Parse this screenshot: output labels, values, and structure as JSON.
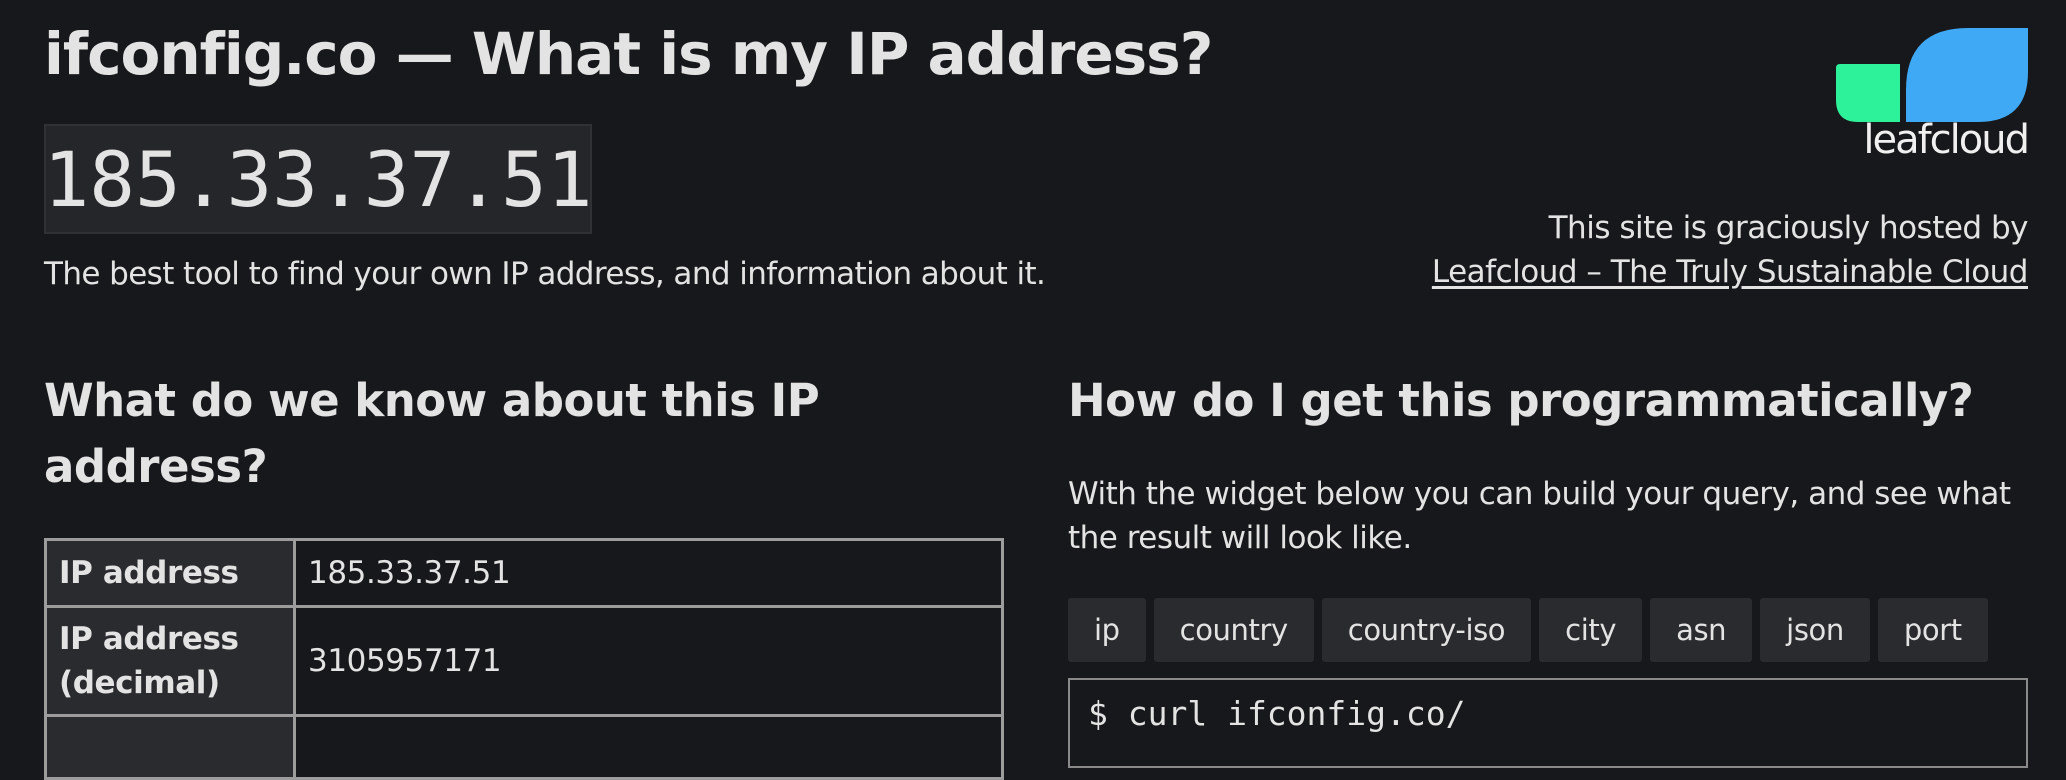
{
  "header": {
    "title": "ifconfig.co — What is my IP address?",
    "ip": "185.33.37.51",
    "tagline": "The best tool to find your own IP address, and information about it."
  },
  "sponsor": {
    "logo_text": "leafcloud",
    "logo_colors": {
      "green": "#2ef29a",
      "blue": "#3fa9f5"
    },
    "hosted_text": "This site is graciously hosted by",
    "link_text": "Leafcloud – The Truly Sustainable Cloud"
  },
  "info": {
    "heading": "What do we know about this IP address?",
    "rows": [
      {
        "label": "IP address",
        "value": "185.33.37.51"
      },
      {
        "label": "IP address (decimal)",
        "value": "3105957171"
      },
      {
        "label": "",
        "value": ""
      }
    ]
  },
  "programmatic": {
    "heading": "How do I get this programmatically?",
    "intro": "With the widget below you can build your query, and see what the result will look like.",
    "tabs": [
      "ip",
      "country",
      "country-iso",
      "city",
      "asn",
      "json",
      "port"
    ],
    "command": "$ curl ifconfig.co/"
  }
}
